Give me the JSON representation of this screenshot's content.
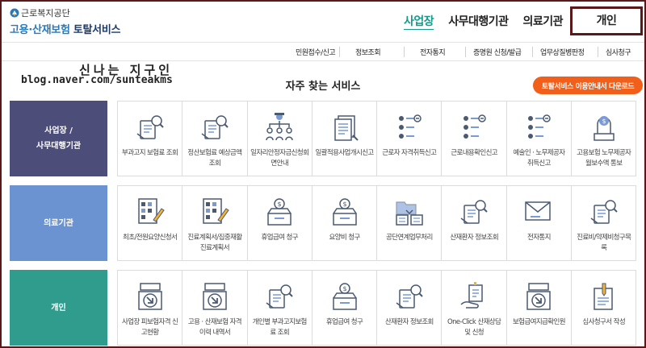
{
  "header": {
    "org_name": "근로복지공단",
    "service_title_a": "고용·산재보험",
    "service_title_b": " 토탈서비스"
  },
  "top_nav": [
    {
      "label": "사업장",
      "active": true
    },
    {
      "label": "사무대행기관",
      "active": false
    },
    {
      "label": "의료기관",
      "active": false
    },
    {
      "label": "개인",
      "active": false
    }
  ],
  "sub_nav": [
    "민원접수/신고",
    "정보조회",
    "전자통지",
    "증명원 신청/발급",
    "업무상질병판정",
    "심사청구"
  ],
  "watermark": {
    "line1": "신나는 지구인",
    "line2": "blog.naver.com/sunteakms"
  },
  "section_title": "자주 찾는 서비스",
  "download_button": "토탈서비스 이용안내서 다운로드",
  "rows": [
    {
      "category": [
        "사업장 /",
        "사무대행기관"
      ],
      "items": [
        {
          "icon": "document-search-icon",
          "label": "부과고지 보험료 조회"
        },
        {
          "icon": "document-search-icon",
          "label": "정산보험료 예상금액 조회"
        },
        {
          "icon": "people-network-icon",
          "label": "일자리안정자금신청회면안내"
        },
        {
          "icon": "document-stack-icon",
          "label": "일괄적용사업개시신고"
        },
        {
          "icon": "user-list-icon",
          "label": "근로자 자격취득신고"
        },
        {
          "icon": "user-list-icon",
          "label": "근로내용확인신고"
        },
        {
          "icon": "user-list-icon",
          "label": "예술인 · 노무제공자 취득신고"
        },
        {
          "icon": "lock-payment-icon",
          "label": "고용보험 노무제공자 월보수액 통보"
        }
      ]
    },
    {
      "category": [
        "의료기관"
      ],
      "items": [
        {
          "icon": "calendar-pen-icon",
          "label": "최초/전원요양신청서"
        },
        {
          "icon": "calendar-pen-icon",
          "label": "진료계획서/집중재활진료계획서"
        },
        {
          "icon": "money-box-icon",
          "label": "휴업급여 청구"
        },
        {
          "icon": "money-box-icon",
          "label": "요양비 청구"
        },
        {
          "icon": "folder-exchange-icon",
          "label": "공단연계업무처리"
        },
        {
          "icon": "document-search-icon",
          "label": "산재환자 정보조회"
        },
        {
          "icon": "mail-box-icon",
          "label": "전자통지"
        },
        {
          "icon": "document-search-icon",
          "label": "진료비/약제비청구목록"
        }
      ]
    },
    {
      "category": [
        "개인"
      ],
      "items": [
        {
          "icon": "tray-arrow-icon",
          "label": "사업장 피보험자격 신고현황"
        },
        {
          "icon": "tray-arrow-icon",
          "label": "고용 · 산재보험 자격 이력 내역서"
        },
        {
          "icon": "document-search-icon",
          "label": "개인별 부과고지보험료 조회"
        },
        {
          "icon": "money-box-icon",
          "label": "휴업급여 청구"
        },
        {
          "icon": "document-search-icon",
          "label": "산재환자 정보조회"
        },
        {
          "icon": "hand-document-icon",
          "label": "One-Click 산재상담 및 신청"
        },
        {
          "icon": "tray-arrow-icon",
          "label": "보험급여지급확인원"
        },
        {
          "icon": "pen-document-icon",
          "label": "심사청구서 작성"
        }
      ]
    }
  ],
  "colors": {
    "category_business": "#4d4d7a",
    "category_medical": "#6b93d1",
    "category_personal": "#2f9c8e",
    "download_button": "#f25f1b",
    "active_nav": "#159a8a"
  }
}
